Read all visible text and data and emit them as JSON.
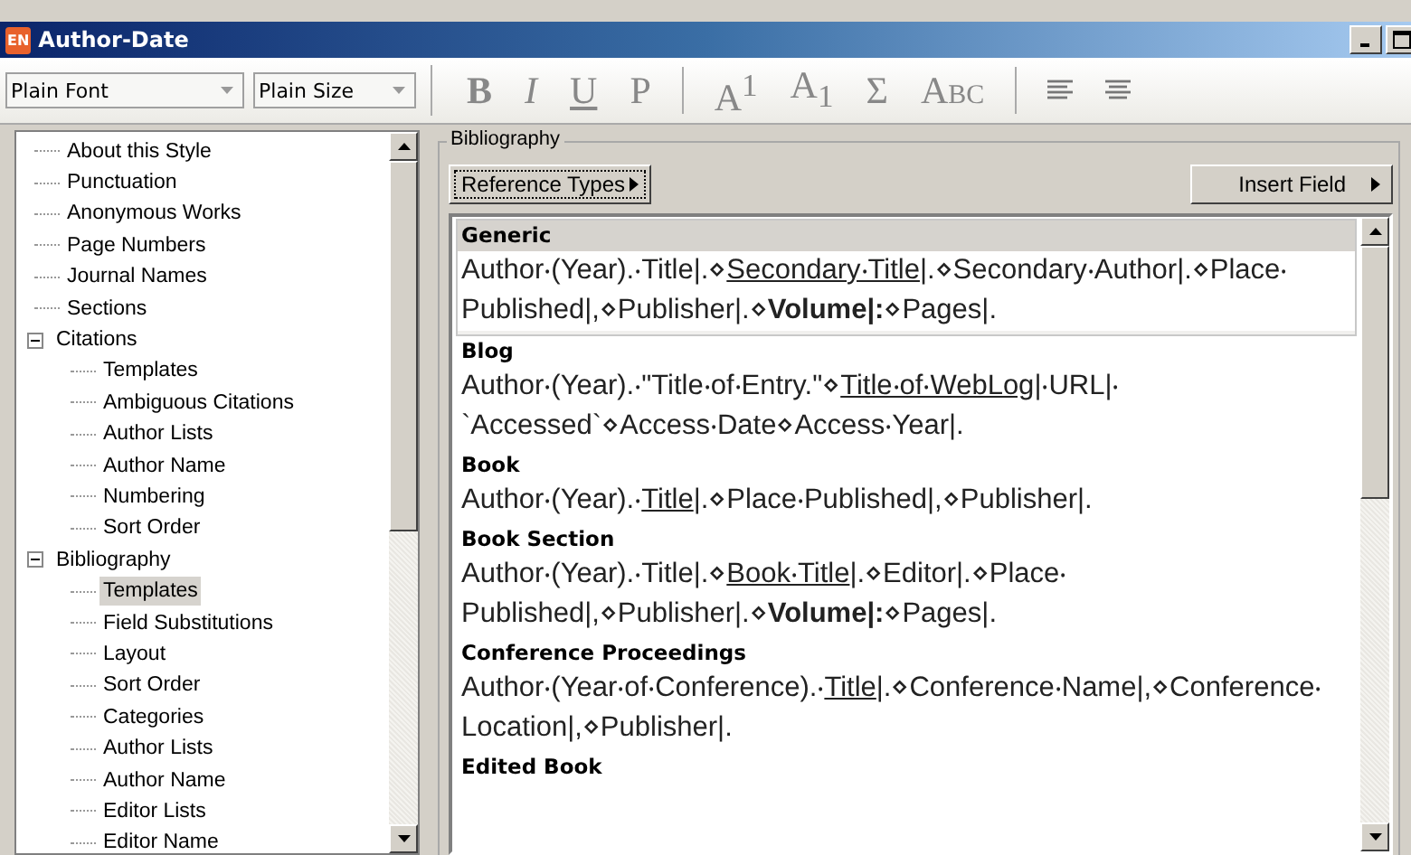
{
  "window": {
    "icon_text": "EN",
    "title": "Author-Date"
  },
  "toolbar": {
    "font_dropdown": "Plain Font",
    "size_dropdown": "Plain Size",
    "format_buttons": [
      {
        "label": "B",
        "kind": "bold"
      },
      {
        "label": "I",
        "kind": "italic"
      },
      {
        "label": "U",
        "kind": "underline"
      },
      {
        "label": "P",
        "kind": "plain"
      },
      {
        "label": "A$^{1}$",
        "kind": "script"
      },
      {
        "label": "A$_{1}$",
        "kind": "script"
      },
      {
        "label": "Σ",
        "kind": "plain"
      },
      {
        "label": "Abc",
        "kind": "smallcaps"
      }
    ]
  },
  "tree": [
    {
      "label": "About this Style",
      "selected": false
    },
    {
      "label": "Punctuation",
      "selected": false
    },
    {
      "label": "Anonymous Works",
      "selected": false
    },
    {
      "label": "Page Numbers",
      "selected": false
    },
    {
      "label": "Journal Names",
      "selected": false
    },
    {
      "label": "Sections",
      "selected": false
    },
    {
      "label": "Citations",
      "selected": false,
      "expanded": true,
      "children": [
        {
          "label": "Templates",
          "selected": false
        },
        {
          "label": "Ambiguous Citations",
          "selected": false
        },
        {
          "label": "Author Lists",
          "selected": false
        },
        {
          "label": "Author Name",
          "selected": false
        },
        {
          "label": "Numbering",
          "selected": false
        },
        {
          "label": "Sort Order",
          "selected": false
        }
      ]
    },
    {
      "label": "Bibliography",
      "selected": false,
      "expanded": true,
      "children": [
        {
          "label": "Templates",
          "selected": true
        },
        {
          "label": "Field Substitutions",
          "selected": false
        },
        {
          "label": "Layout",
          "selected": false
        },
        {
          "label": "Sort Order",
          "selected": false
        },
        {
          "label": "Categories",
          "selected": false
        },
        {
          "label": "Author Lists",
          "selected": false
        },
        {
          "label": "Author Name",
          "selected": false
        },
        {
          "label": "Editor Lists",
          "selected": false
        },
        {
          "label": "Editor Name",
          "selected": false
        }
      ]
    }
  ],
  "panel": {
    "group_title": "Bibliography",
    "reference_types_button": "Reference Types",
    "insert_field_button": "Insert Field",
    "templates": [
      {
        "type": "Generic",
        "selected": true,
        "segments": [
          {
            "text": "Author‧(Year).‧Title|.⋄",
            "kind": "plain"
          },
          {
            "text": "Secondary‧Title",
            "kind": "underline"
          },
          {
            "text": "|.⋄Secondary‧Author|.⋄Place‧Published|,⋄Publisher|.⋄",
            "kind": "plain"
          },
          {
            "text": "Volume|:",
            "kind": "bold"
          },
          {
            "text": "⋄Pages|.",
            "kind": "plain"
          }
        ]
      },
      {
        "type": "Blog",
        "selected": false,
        "segments": [
          {
            "text": "Author‧(Year).‧\"Title‧of‧Entry.\"⋄",
            "kind": "plain"
          },
          {
            "text": "Title‧of‧WebLog",
            "kind": "underline"
          },
          {
            "text": "|‧URL|‧`Accessed`⋄Access‧Date⋄Access‧Year|.",
            "kind": "plain"
          }
        ]
      },
      {
        "type": "Book",
        "selected": false,
        "segments": [
          {
            "text": "Author‧(Year).‧",
            "kind": "plain"
          },
          {
            "text": "Title",
            "kind": "underline"
          },
          {
            "text": "|.⋄Place‧Published|,⋄Publisher|.",
            "kind": "plain"
          }
        ]
      },
      {
        "type": "Book Section",
        "selected": false,
        "segments": [
          {
            "text": "Author‧(Year).‧Title|.⋄",
            "kind": "plain"
          },
          {
            "text": "Book‧Title",
            "kind": "underline"
          },
          {
            "text": "|.⋄Editor|.⋄Place‧Published|,⋄Publisher|.⋄",
            "kind": "plain"
          },
          {
            "text": "Volume|:",
            "kind": "bold"
          },
          {
            "text": "⋄Pages|.",
            "kind": "plain"
          }
        ]
      },
      {
        "type": "Conference Proceedings",
        "selected": false,
        "segments": [
          {
            "text": "Author‧(Year‧of‧Conference).‧",
            "kind": "plain"
          },
          {
            "text": "Title",
            "kind": "underline"
          },
          {
            "text": "|.⋄Conference‧Name|,⋄Conference‧Location|,⋄Publisher|.",
            "kind": "plain"
          }
        ]
      },
      {
        "type": "Edited Book",
        "selected": false
      }
    ]
  }
}
